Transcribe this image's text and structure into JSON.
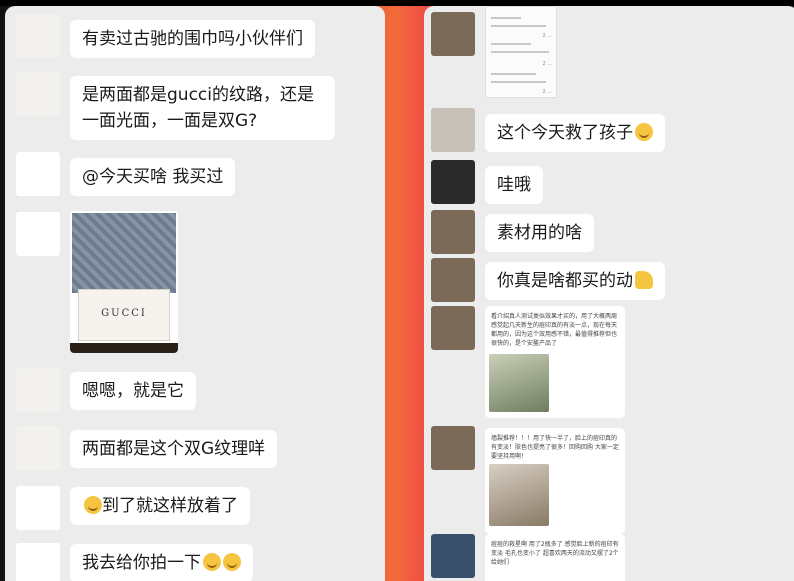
{
  "left_chat": [
    {
      "text": "有卖过古驰的围巾吗小伙伴们"
    },
    {
      "text": "是两面都是gucci的纹路，还是一面光面，一面是双G?"
    },
    {
      "text": "@今天买啥 我买过"
    },
    {
      "photo_brand": "GUCCI"
    },
    {
      "text": "嗯嗯，就是它"
    },
    {
      "text": "两面都是这个双G纹理咩"
    },
    {
      "text": "到了就这样放着了",
      "emoji_before": "laughing-cry-emoji"
    },
    {
      "text": "我去给你拍一下",
      "emoji_after": [
        "laughing-cry-emoji",
        "laughing-cry-emoji"
      ]
    }
  ],
  "right_chat": [
    {
      "screenshot_lines": [
        "2 ...",
        "2 ...",
        "2 ..."
      ]
    },
    {
      "text": "这个今天救了孩子",
      "emoji_after": "grimace-emoji"
    },
    {
      "text": "哇哦"
    },
    {
      "text": "素材用的啥"
    },
    {
      "text": "你真是啥都买的动",
      "emoji_after": "thumbs-up-emoji"
    },
    {
      "small_text": "看介绍真人测试类似效果才买的，用了大概两周感觉起几天新生的痘印真的有淡一点，现在每天都用的，因为这个效用感不错，最值得推荐但也很快的，是个安鳌产品了"
    },
    {
      "small_text": "墙裂推荐！！！用了快一半了，脸上的痘印真的有变淡！肤色也提亮了很多！回购回购 大家一定要坚持用啊！"
    },
    {
      "small_text": "痘痘的救星啊 用了2瓶多了 感觉脸上新的痘印有变淡 毛孔也变小了 超喜欢两天的流动又摆了2个给她们"
    }
  ],
  "colors": {
    "chat_bg": "#ececec",
    "bubble_bg": "#ffffff",
    "divider_gradient": [
      "#f36a3a",
      "#ef4b46"
    ]
  }
}
